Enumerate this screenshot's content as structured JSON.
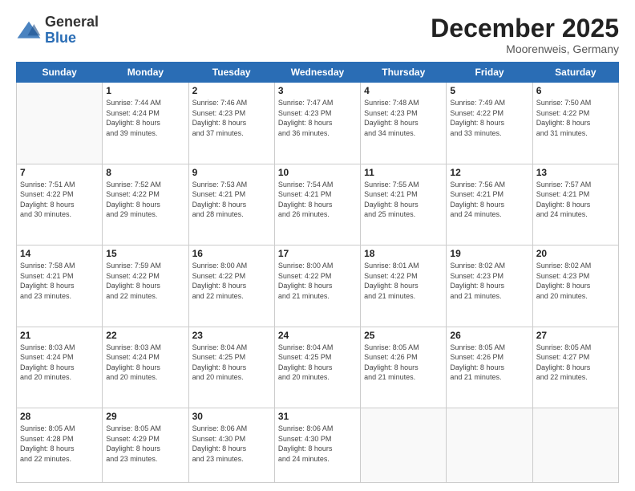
{
  "header": {
    "logo_general": "General",
    "logo_blue": "Blue",
    "month_title": "December 2025",
    "subtitle": "Moorenweis, Germany"
  },
  "weekdays": [
    "Sunday",
    "Monday",
    "Tuesday",
    "Wednesday",
    "Thursday",
    "Friday",
    "Saturday"
  ],
  "weeks": [
    [
      {
        "day": "",
        "info": ""
      },
      {
        "day": "1",
        "info": "Sunrise: 7:44 AM\nSunset: 4:24 PM\nDaylight: 8 hours\nand 39 minutes."
      },
      {
        "day": "2",
        "info": "Sunrise: 7:46 AM\nSunset: 4:23 PM\nDaylight: 8 hours\nand 37 minutes."
      },
      {
        "day": "3",
        "info": "Sunrise: 7:47 AM\nSunset: 4:23 PM\nDaylight: 8 hours\nand 36 minutes."
      },
      {
        "day": "4",
        "info": "Sunrise: 7:48 AM\nSunset: 4:23 PM\nDaylight: 8 hours\nand 34 minutes."
      },
      {
        "day": "5",
        "info": "Sunrise: 7:49 AM\nSunset: 4:22 PM\nDaylight: 8 hours\nand 33 minutes."
      },
      {
        "day": "6",
        "info": "Sunrise: 7:50 AM\nSunset: 4:22 PM\nDaylight: 8 hours\nand 31 minutes."
      }
    ],
    [
      {
        "day": "7",
        "info": "Sunrise: 7:51 AM\nSunset: 4:22 PM\nDaylight: 8 hours\nand 30 minutes."
      },
      {
        "day": "8",
        "info": "Sunrise: 7:52 AM\nSunset: 4:22 PM\nDaylight: 8 hours\nand 29 minutes."
      },
      {
        "day": "9",
        "info": "Sunrise: 7:53 AM\nSunset: 4:21 PM\nDaylight: 8 hours\nand 28 minutes."
      },
      {
        "day": "10",
        "info": "Sunrise: 7:54 AM\nSunset: 4:21 PM\nDaylight: 8 hours\nand 26 minutes."
      },
      {
        "day": "11",
        "info": "Sunrise: 7:55 AM\nSunset: 4:21 PM\nDaylight: 8 hours\nand 25 minutes."
      },
      {
        "day": "12",
        "info": "Sunrise: 7:56 AM\nSunset: 4:21 PM\nDaylight: 8 hours\nand 24 minutes."
      },
      {
        "day": "13",
        "info": "Sunrise: 7:57 AM\nSunset: 4:21 PM\nDaylight: 8 hours\nand 24 minutes."
      }
    ],
    [
      {
        "day": "14",
        "info": "Sunrise: 7:58 AM\nSunset: 4:21 PM\nDaylight: 8 hours\nand 23 minutes."
      },
      {
        "day": "15",
        "info": "Sunrise: 7:59 AM\nSunset: 4:22 PM\nDaylight: 8 hours\nand 22 minutes."
      },
      {
        "day": "16",
        "info": "Sunrise: 8:00 AM\nSunset: 4:22 PM\nDaylight: 8 hours\nand 22 minutes."
      },
      {
        "day": "17",
        "info": "Sunrise: 8:00 AM\nSunset: 4:22 PM\nDaylight: 8 hours\nand 21 minutes."
      },
      {
        "day": "18",
        "info": "Sunrise: 8:01 AM\nSunset: 4:22 PM\nDaylight: 8 hours\nand 21 minutes."
      },
      {
        "day": "19",
        "info": "Sunrise: 8:02 AM\nSunset: 4:23 PM\nDaylight: 8 hours\nand 21 minutes."
      },
      {
        "day": "20",
        "info": "Sunrise: 8:02 AM\nSunset: 4:23 PM\nDaylight: 8 hours\nand 20 minutes."
      }
    ],
    [
      {
        "day": "21",
        "info": "Sunrise: 8:03 AM\nSunset: 4:24 PM\nDaylight: 8 hours\nand 20 minutes."
      },
      {
        "day": "22",
        "info": "Sunrise: 8:03 AM\nSunset: 4:24 PM\nDaylight: 8 hours\nand 20 minutes."
      },
      {
        "day": "23",
        "info": "Sunrise: 8:04 AM\nSunset: 4:25 PM\nDaylight: 8 hours\nand 20 minutes."
      },
      {
        "day": "24",
        "info": "Sunrise: 8:04 AM\nSunset: 4:25 PM\nDaylight: 8 hours\nand 20 minutes."
      },
      {
        "day": "25",
        "info": "Sunrise: 8:05 AM\nSunset: 4:26 PM\nDaylight: 8 hours\nand 21 minutes."
      },
      {
        "day": "26",
        "info": "Sunrise: 8:05 AM\nSunset: 4:26 PM\nDaylight: 8 hours\nand 21 minutes."
      },
      {
        "day": "27",
        "info": "Sunrise: 8:05 AM\nSunset: 4:27 PM\nDaylight: 8 hours\nand 22 minutes."
      }
    ],
    [
      {
        "day": "28",
        "info": "Sunrise: 8:05 AM\nSunset: 4:28 PM\nDaylight: 8 hours\nand 22 minutes."
      },
      {
        "day": "29",
        "info": "Sunrise: 8:05 AM\nSunset: 4:29 PM\nDaylight: 8 hours\nand 23 minutes."
      },
      {
        "day": "30",
        "info": "Sunrise: 8:06 AM\nSunset: 4:30 PM\nDaylight: 8 hours\nand 23 minutes."
      },
      {
        "day": "31",
        "info": "Sunrise: 8:06 AM\nSunset: 4:30 PM\nDaylight: 8 hours\nand 24 minutes."
      },
      {
        "day": "",
        "info": ""
      },
      {
        "day": "",
        "info": ""
      },
      {
        "day": "",
        "info": ""
      }
    ]
  ]
}
